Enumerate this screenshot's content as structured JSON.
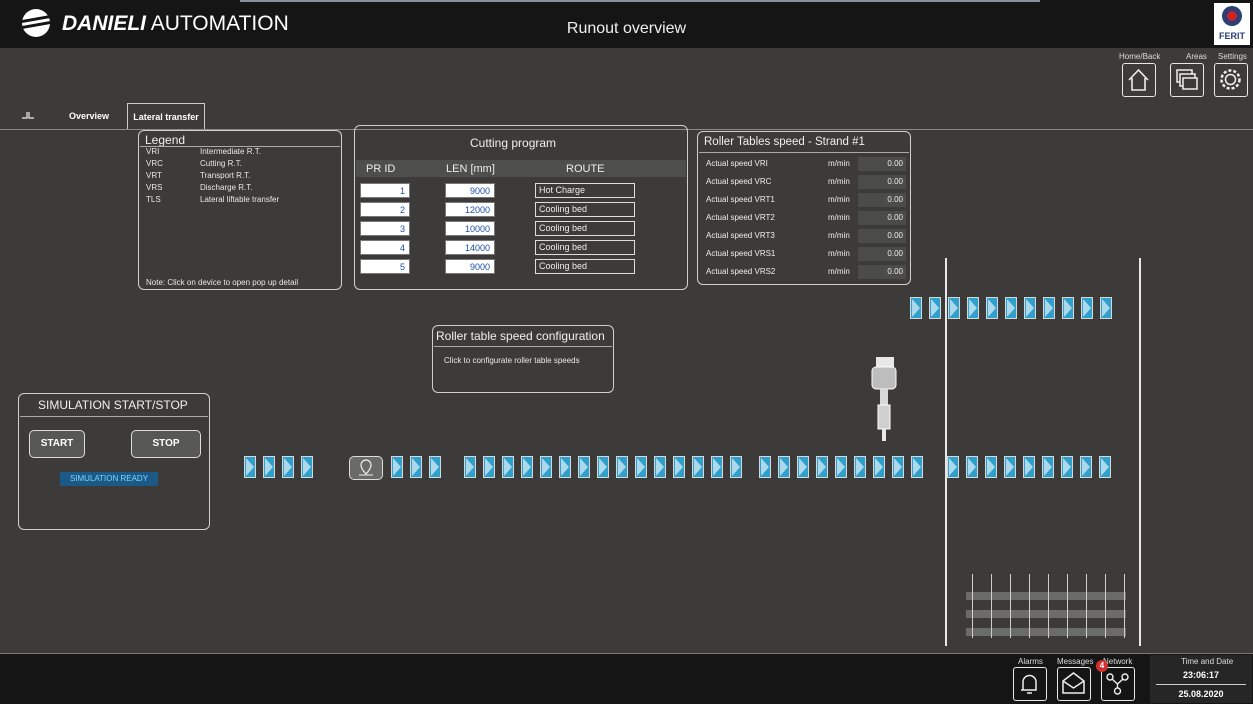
{
  "header": {
    "brand_bold": "DANIELI",
    "brand_rest": "AUTOMATION",
    "title": "Runout overview",
    "logo_text": "FERIT"
  },
  "nav": {
    "home_label": "Home/Back",
    "areas_label": "Areas",
    "settings_label": "Settings"
  },
  "tabs": [
    {
      "label": "Overview"
    },
    {
      "label": "Lateral transfer"
    }
  ],
  "legend": {
    "title": "Legend",
    "items": [
      {
        "code": "VRI",
        "desc": "Intermediate R.T."
      },
      {
        "code": "VRC",
        "desc": "Cutting R.T."
      },
      {
        "code": "VRT",
        "desc": "Transport R.T."
      },
      {
        "code": "VRS",
        "desc": "Discharge R.T."
      },
      {
        "code": "TLS",
        "desc": "Lateral liftable transfer"
      }
    ],
    "note": "Note: Click on device to open pop up detail"
  },
  "cutting": {
    "title": "Cutting program",
    "col_id": "PR ID",
    "col_len": "LEN [mm]",
    "col_route": "ROUTE",
    "rows": [
      {
        "id": "1",
        "len": "9000",
        "route": "Hot Charge"
      },
      {
        "id": "2",
        "len": "12000",
        "route": "Cooling bed"
      },
      {
        "id": "3",
        "len": "10000",
        "route": "Cooling bed"
      },
      {
        "id": "4",
        "len": "14000",
        "route": "Cooling bed"
      },
      {
        "id": "5",
        "len": "9000",
        "route": "Cooling bed"
      }
    ]
  },
  "speeds": {
    "title": "Roller Tables speed - Strand #1",
    "unit": "m/min",
    "rows": [
      {
        "label": "Actual speed VRI",
        "value": "0.00"
      },
      {
        "label": "Actual speed VRC",
        "value": "0.00"
      },
      {
        "label": "Actual speed VRT1",
        "value": "0.00"
      },
      {
        "label": "Actual speed VRT2",
        "value": "0.00"
      },
      {
        "label": "Actual speed VRT3",
        "value": "0.00"
      },
      {
        "label": "Actual speed VRS1",
        "value": "0.00"
      },
      {
        "label": "Actual speed VRS2",
        "value": "0.00"
      }
    ]
  },
  "config": {
    "title": "Roller table speed configuration",
    "text": "Click to configurate roller table speeds"
  },
  "simulation": {
    "title": "SIMULATION START/STOP",
    "start": "START",
    "stop": "STOP",
    "status": "SIMULATION READY"
  },
  "footer": {
    "alarms_label": "Alarms",
    "messages_label": "Messages",
    "network_label": "Network",
    "badge_count": "4",
    "time_label": "Time and Date",
    "time": "23:06:17",
    "date": "25.08.2020"
  },
  "colors": {
    "background": "#3c3b39",
    "bar": "#151515",
    "roller": "#2fa0cc",
    "ready": "#1b5a86",
    "badge": "#d0312d"
  }
}
